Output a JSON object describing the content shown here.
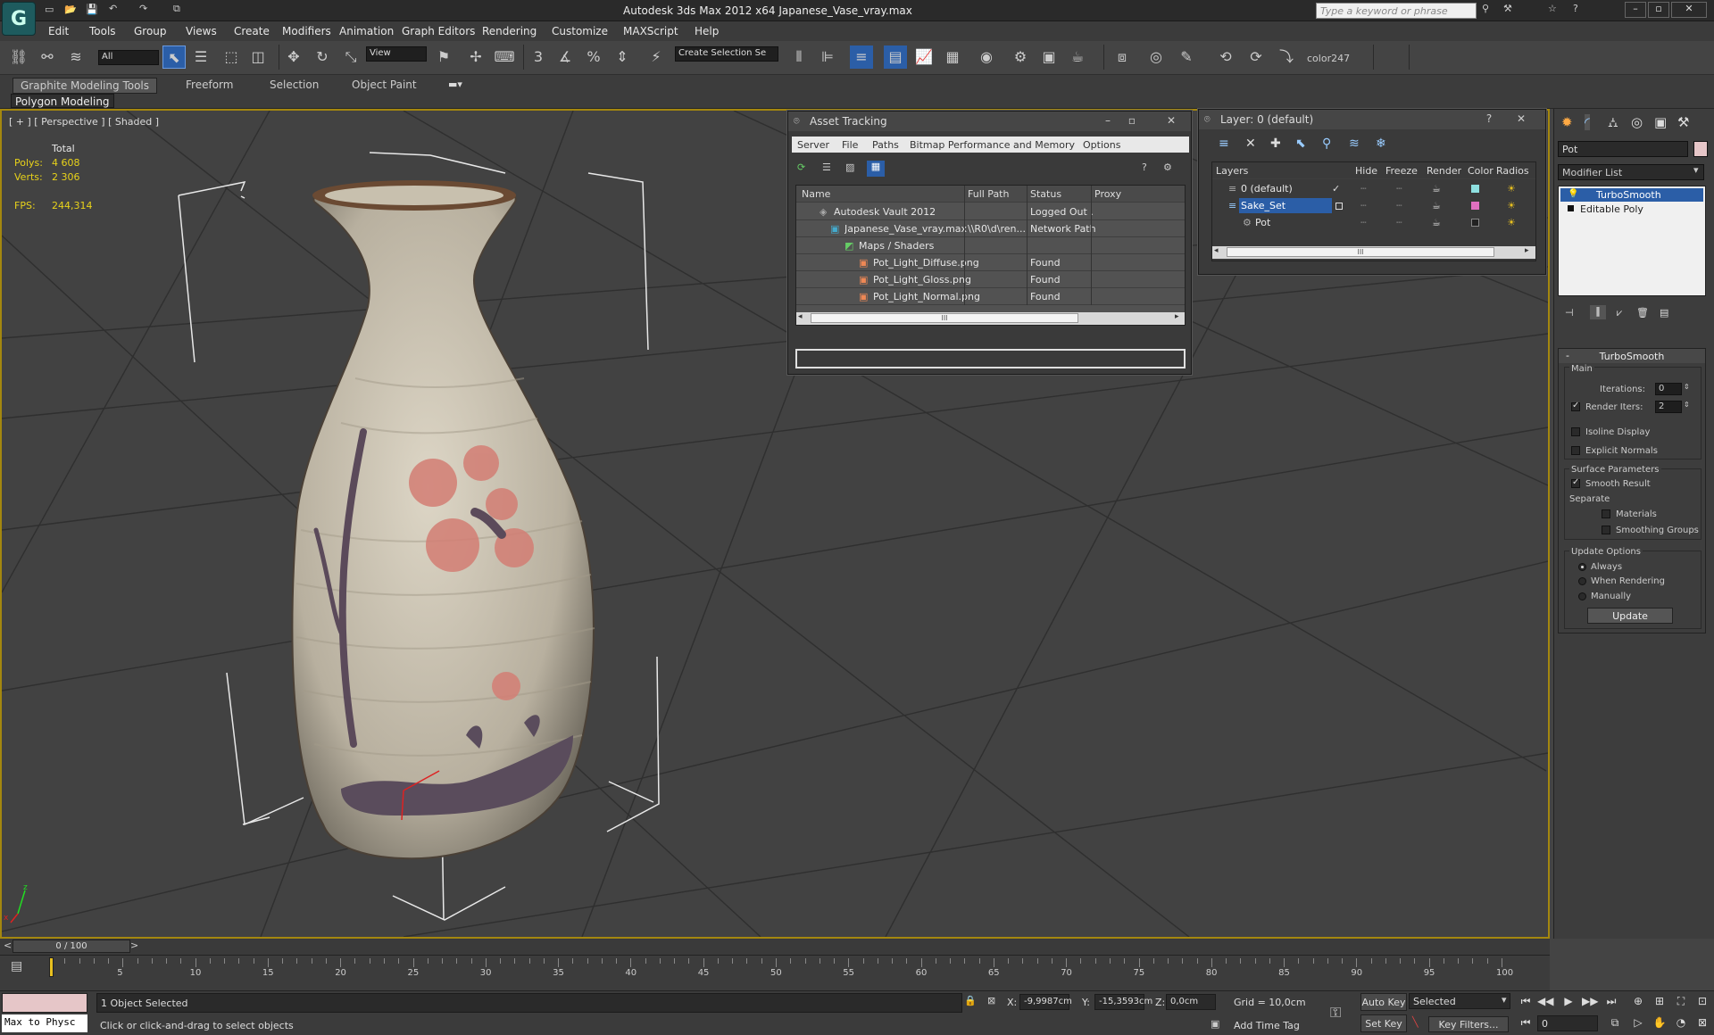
{
  "app": {
    "title": "Autodesk 3ds Max  2012 x64    Japanese_Vase_vray.max",
    "search_placeholder": "Type a keyword or phrase",
    "logo": "max-logo"
  },
  "menu": [
    "Edit",
    "Tools",
    "Group",
    "Views",
    "Create",
    "Modifiers",
    "Animation",
    "Graph Editors",
    "Rendering",
    "Customize",
    "MAXScript",
    "Help"
  ],
  "toolbar": {
    "selection_filter": "All",
    "ref_coord": "View",
    "named_selection": "Create Selection Se",
    "color_label": "color247",
    "snap_3": "3",
    "snap_pct": "%"
  },
  "ribbon": {
    "tabs": [
      "Graphite Modeling Tools",
      "Freeform",
      "Selection",
      "Object Paint"
    ],
    "sub": "Polygon Modeling"
  },
  "viewport": {
    "label": "[ + ] [ Perspective ] [ Shaded ]",
    "stats": {
      "total": "Total",
      "polys_label": "Polys:",
      "polys": "4 608",
      "verts_label": "Verts:",
      "verts": "2 306",
      "fps_label": "FPS:",
      "fps": "244,314"
    },
    "axis_z": "z",
    "axis_x": "x"
  },
  "asset_tracking": {
    "title": "Asset Tracking",
    "menu": [
      "Server",
      "File",
      "Paths",
      "Bitmap Performance and Memory",
      "Options"
    ],
    "columns": [
      "Name",
      "Full Path",
      "Status",
      "Proxy"
    ],
    "rows": [
      {
        "name": "Autodesk Vault 2012",
        "path": "",
        "status": "Logged Out ...",
        "indent": 0
      },
      {
        "name": "Japanese_Vase_vray.max",
        "path": "\\\\R0\\d\\ren...",
        "status": "Network Path",
        "indent": 1
      },
      {
        "name": "Maps / Shaders",
        "path": "",
        "status": "",
        "indent": 2
      },
      {
        "name": "Pot_Light_Diffuse.png",
        "path": "",
        "status": "Found",
        "indent": 3
      },
      {
        "name": "Pot_Light_Gloss.png",
        "path": "",
        "status": "Found",
        "indent": 3
      },
      {
        "name": "Pot_Light_Normal.png",
        "path": "",
        "status": "Found",
        "indent": 3
      }
    ],
    "scroll_grip": "III"
  },
  "layer_window": {
    "title": "Layer: 0 (default)",
    "columns": [
      "Layers",
      "Hide",
      "Freeze",
      "Render",
      "Color",
      "Radios"
    ],
    "rows": [
      {
        "name": "0 (default)",
        "color": "#8ee0e0",
        "selected": false
      },
      {
        "name": "Sake_Set",
        "color": "#e070c0",
        "selected": true
      },
      {
        "name": "Pot",
        "color": "#222222",
        "selected": false
      }
    ],
    "scroll_grip": "III"
  },
  "command_panel": {
    "object_name": "Pot",
    "modifier_list": "Modifier List",
    "stack": [
      "TurboSmooth",
      "Editable Poly"
    ],
    "rollout_title": "TurboSmooth",
    "main": "Main",
    "iterations_label": "Iterations:",
    "iterations": "0",
    "render_iters_label": "Render Iters:",
    "render_iters": "2",
    "isoline": "Isoline Display",
    "explicit": "Explicit Normals",
    "surface_params": "Surface Parameters",
    "smooth_result": "Smooth Result",
    "separate": "Separate",
    "materials": "Materials",
    "smoothing_groups": "Smoothing Groups",
    "update_options": "Update Options",
    "always": "Always",
    "when_rendering": "When Rendering",
    "manually": "Manually",
    "update_btn": "Update",
    "collapse": "-"
  },
  "timeline": {
    "frame": "0 / 100",
    "ticks": [
      "5",
      "10",
      "15",
      "20",
      "25",
      "30",
      "35",
      "40",
      "45",
      "50",
      "55",
      "60",
      "65",
      "70",
      "75",
      "80",
      "85",
      "90",
      "95",
      "100"
    ]
  },
  "status": {
    "maxscript": "Max to Physc",
    "selected": "1 Object Selected",
    "prompt": "Click or click-and-drag to select objects",
    "x_label": "X:",
    "x": "-9,9987cm",
    "y_label": "Y:",
    "y": "-15,3593cm",
    "z_label": "Z:",
    "z": "0,0cm",
    "grid": "Grid = 10,0cm",
    "add_time_tag": "Add Time Tag",
    "auto_key": "Auto Key",
    "set_key": "Set Key",
    "selected_dd": "Selected",
    "key_filters": "Key Filters...",
    "frame_value": "0"
  },
  "colors": {
    "accent": "#a4870f",
    "selection": "#2b5ea7",
    "swatch": "#e6c6c8"
  }
}
